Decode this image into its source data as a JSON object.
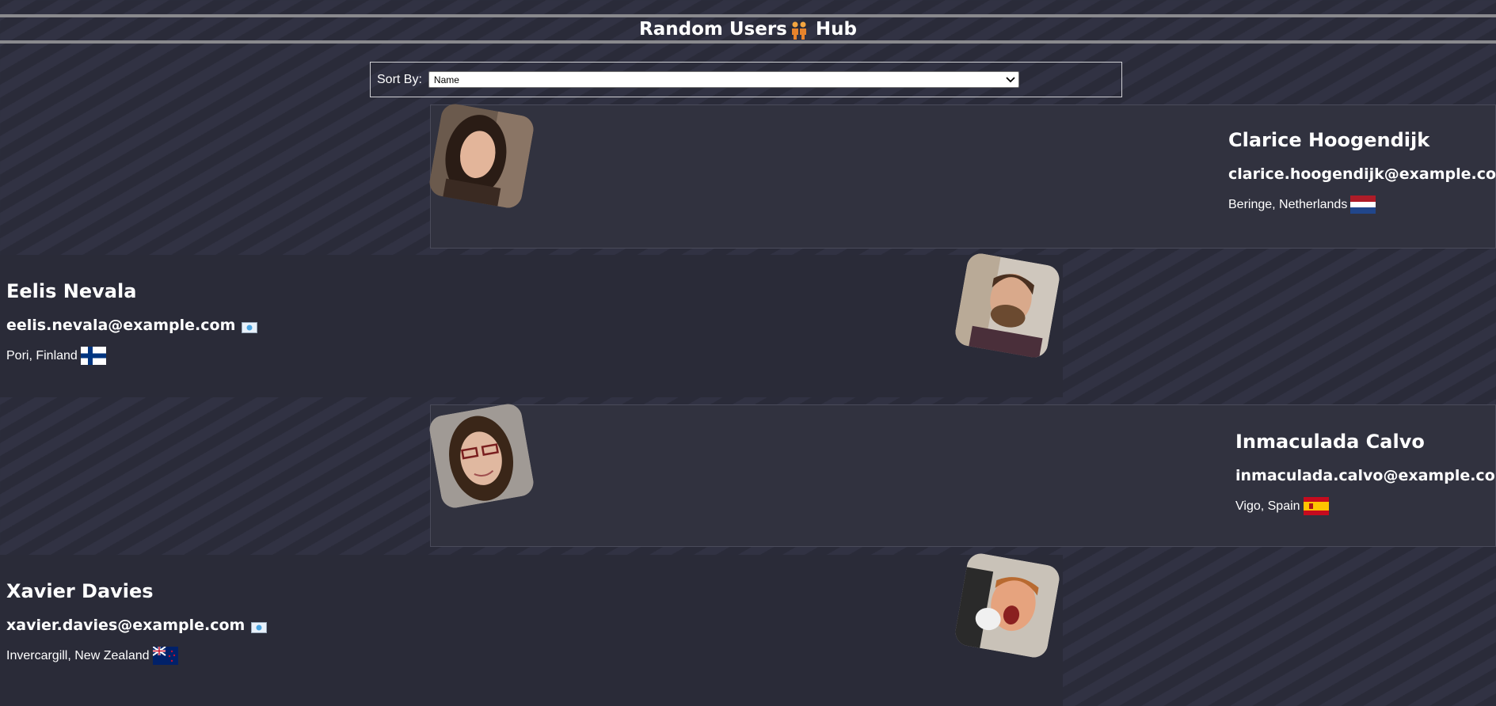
{
  "header": {
    "title_left": "Random Users",
    "title_right": "Hub",
    "icon": "people-icon"
  },
  "sort": {
    "label": "Sort By:",
    "selected": "Name"
  },
  "users": [
    {
      "name": "Clarice Hoogendijk",
      "email": "clarice.hoogendijk@example.com",
      "location": "Beringe, Netherlands",
      "flag": "netherlands-flag-icon"
    },
    {
      "name": "Eelis Nevala",
      "email": "eelis.nevala@example.com",
      "location": "Pori, Finland",
      "flag": "finland-flag-icon"
    },
    {
      "name": "Inmaculada Calvo",
      "email": "inmaculada.calvo@example.com",
      "location": "Vigo, Spain",
      "flag": "spain-flag-icon"
    },
    {
      "name": "Xavier Davies",
      "email": "xavier.davies@example.com",
      "location": "Invercargill, New Zealand",
      "flag": "new-zealand-flag-icon"
    }
  ],
  "colors": {
    "background": "#2b2c3a",
    "card_alt": "#31323f",
    "border": "#8a8a8e"
  }
}
